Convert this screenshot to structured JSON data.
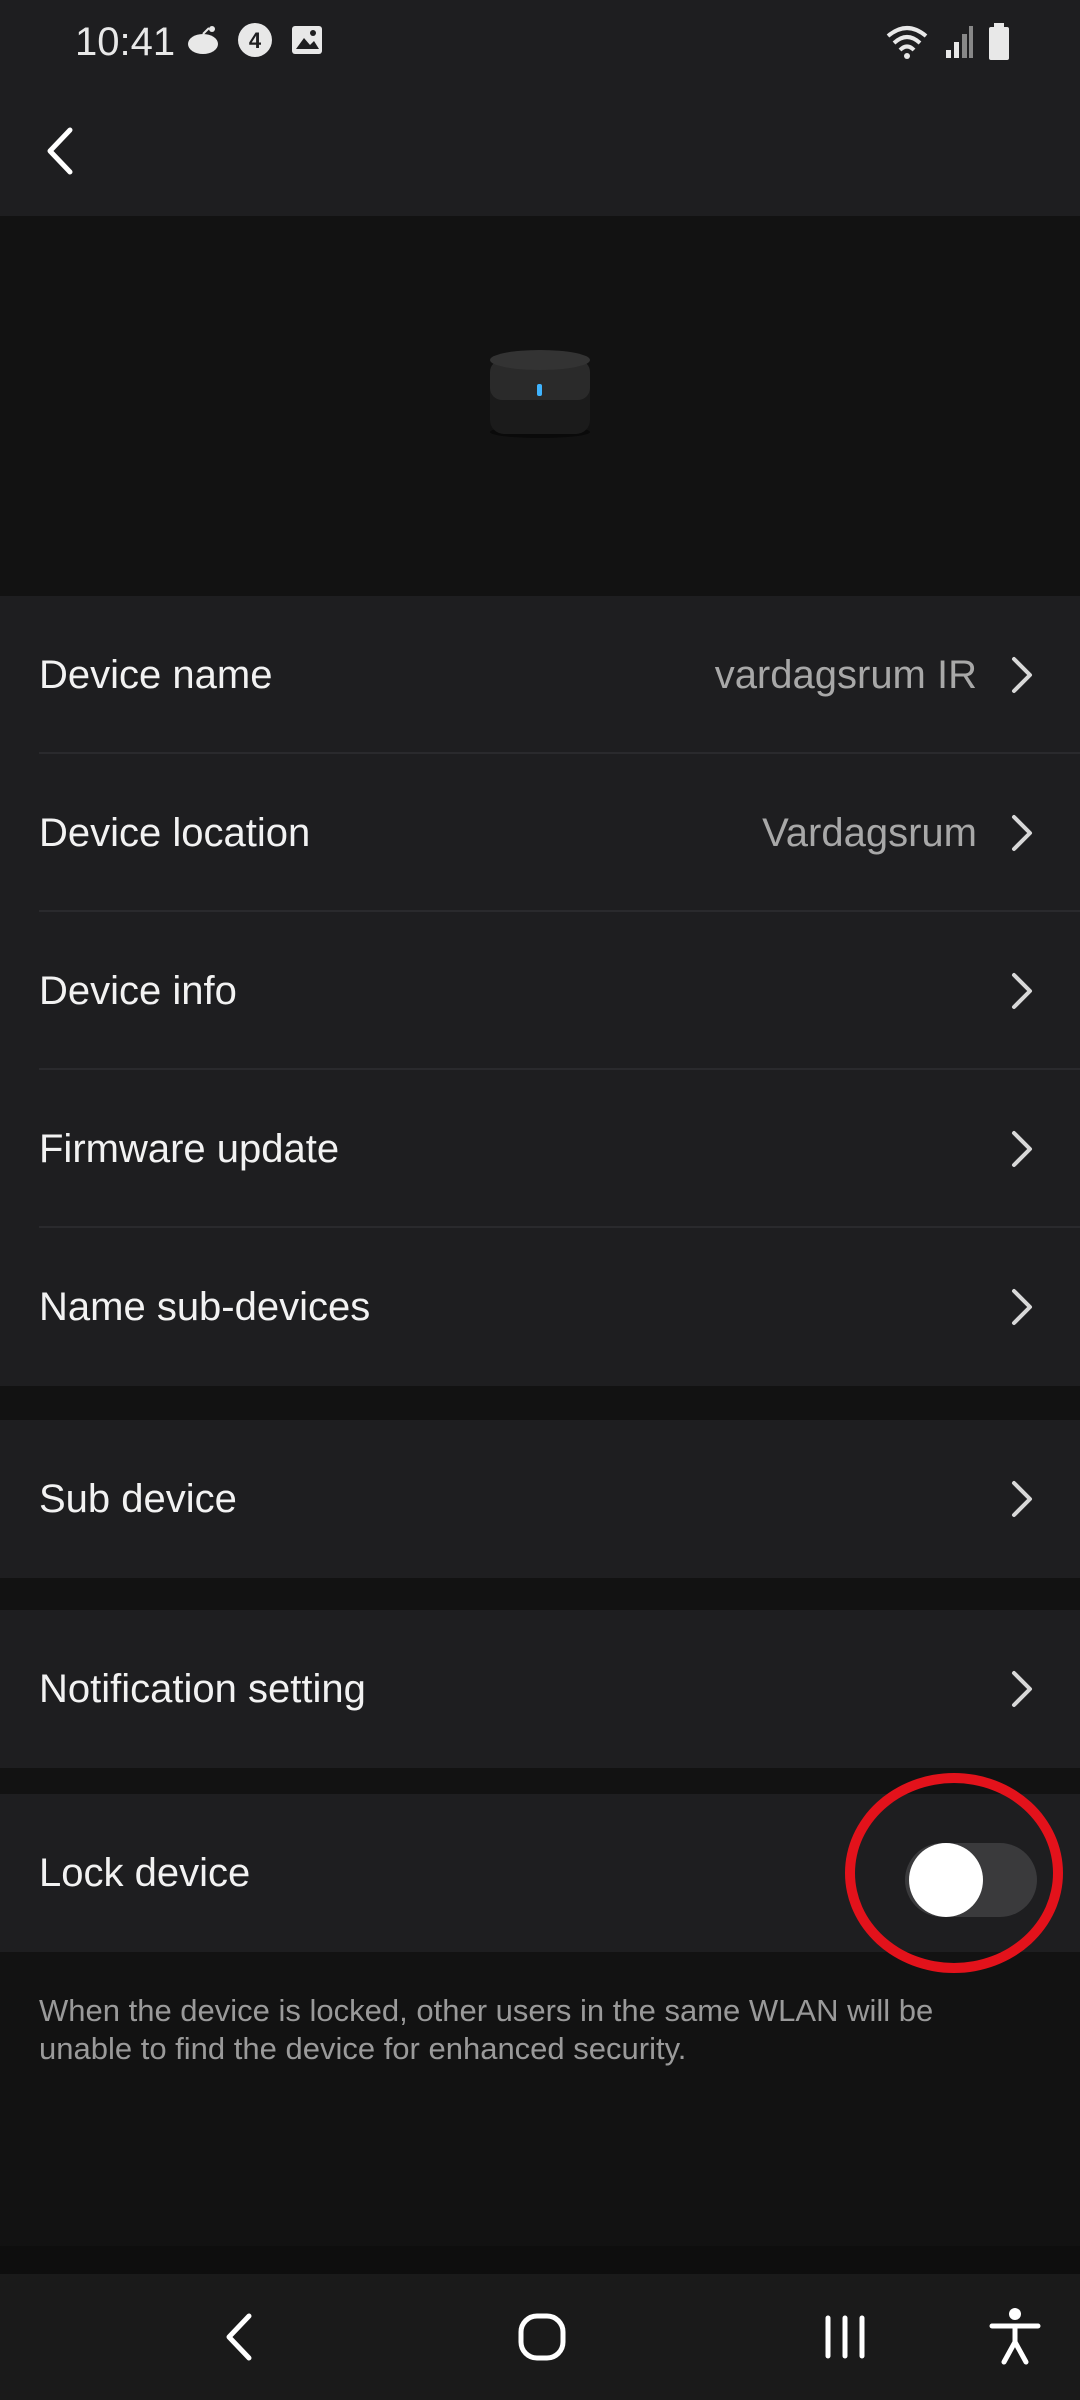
{
  "status_bar": {
    "time": "10:41"
  },
  "settings": {
    "group_main": [
      {
        "label": "Device name",
        "value": "vardagsrum IR"
      },
      {
        "label": "Device location",
        "value": "Vardagsrum"
      },
      {
        "label": "Device info",
        "value": ""
      },
      {
        "label": "Firmware update",
        "value": ""
      },
      {
        "label": "Name sub-devices",
        "value": ""
      }
    ],
    "sub_device": {
      "label": "Sub device"
    },
    "notification": {
      "label": "Notification setting"
    },
    "lock": {
      "label": "Lock device",
      "enabled": false
    },
    "lock_help": "When the device is locked, other users in the same WLAN will be unable to find the device for enhanced security."
  },
  "colors": {
    "background": "#121212",
    "card": "#1e1e20",
    "highlight": "#e3121b"
  },
  "icons": [
    "back-icon",
    "chevron-right-icon",
    "wifi-icon",
    "signal-icon",
    "battery-icon",
    "nav-back-icon",
    "nav-home-icon",
    "nav-recents-icon",
    "accessibility-icon"
  ]
}
